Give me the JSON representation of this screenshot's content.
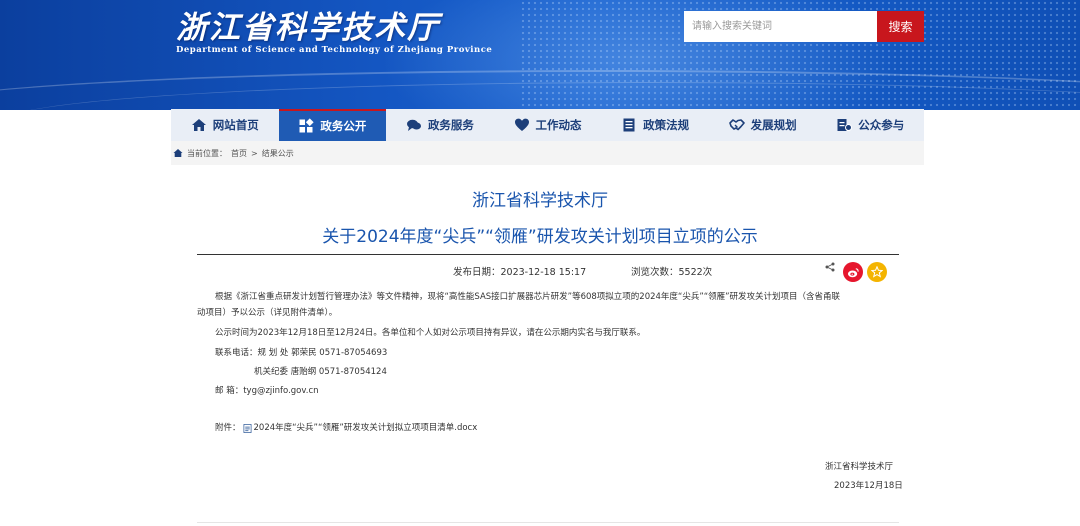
{
  "header": {
    "title": "浙江省科学技术厅",
    "subtitle": "Department of Science and Technology of Zhejiang Province",
    "search_placeholder": "请输入搜索关键词",
    "search_button": "搜索"
  },
  "nav": {
    "items": [
      {
        "label": "网站首页",
        "icon": "home-icon"
      },
      {
        "label": "政务公开",
        "icon": "open-affairs-icon",
        "active": true
      },
      {
        "label": "政务服务",
        "icon": "chat-icon"
      },
      {
        "label": "工作动态",
        "icon": "heart-icon"
      },
      {
        "label": "政策法规",
        "icon": "document-icon"
      },
      {
        "label": "发展规划",
        "icon": "handshake-icon"
      },
      {
        "label": "公众参与",
        "icon": "participation-icon"
      }
    ]
  },
  "breadcrumb": {
    "prefix": "当前位置：",
    "home": "首页",
    "separator": ">",
    "current": "结果公示"
  },
  "article": {
    "org": "浙江省科学技术厅",
    "title": "关于2024年度“尖兵”“领雁”研发攻关计划项目立项的公示",
    "publish_date": "发布日期：2023-12-18 15:17",
    "views": "浏览次数：5522次",
    "para1_line1": "根据《浙江省重点研发计划暂行管理办法》等文件精神，现将“高性能SAS接口扩展器芯片研发”等608项拟立项的2024年度“尖兵”“领雁”研发攻关计划项目（含省甬联",
    "para1_line2": "动项目）予以公示（详见附件清单）。",
    "para2": "公示时间为2023年12月18日至12月24日。各单位和个人如对公示项目持有异议，请在公示期内实名与我厅联系。",
    "contact1": "联系电话：规 划 处   郭荣民   0571-87054693",
    "contact2": "机关纪委   唐贻纲   0571-87054124",
    "email": "邮       箱：tyg@zjinfo.gov.cn",
    "attachment_label": "附件：",
    "attachment_name": "2024年度“尖兵”“领雁”研发攻关计划拟立项项目清单.docx",
    "signature_org": "浙江省科学技术厅",
    "signature_date": "2023年12月18日"
  },
  "colors": {
    "banner": "#1456c2",
    "accent_red": "#c8161d",
    "title_blue": "#1a55ad",
    "nav_active": "#1f5bb4"
  }
}
